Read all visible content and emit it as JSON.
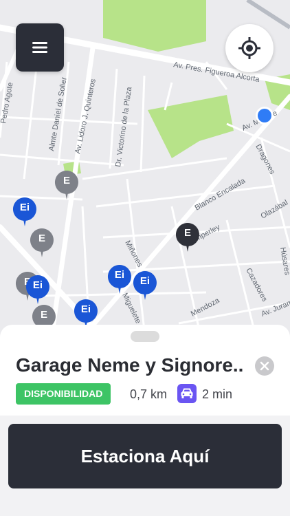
{
  "map": {
    "streets": [
      "Av. Pres. Figueroa Alcorta",
      "Pedro Agote",
      "Almte Daniel de Solier",
      "Av. Lidoro J. Quinteros",
      "Dr. Victorino de la Plaza",
      "Av. Monroe",
      "Dragones",
      "Blanco Encalada",
      "Olazábal",
      "Temperley",
      "Miñones",
      "Cazadores",
      "Mendoza",
      "Miguelete",
      "Av. Juramento",
      "Húsares"
    ],
    "pins": [
      {
        "label": "E",
        "color": "#7e8189"
      },
      {
        "label": "Ei",
        "color": "#1a56d6"
      },
      {
        "label": "E",
        "color": "#7e8189"
      },
      {
        "label": "E",
        "color": "#2f3139"
      },
      {
        "label": "Ei",
        "color": "#1a56d6"
      },
      {
        "label": "Ei",
        "color": "#1a56d6"
      },
      {
        "label": "E",
        "color": "#7e8189"
      },
      {
        "label": "Ei",
        "color": "#1a56d6"
      },
      {
        "label": "E",
        "color": "#7e8189"
      },
      {
        "label": "Ei",
        "color": "#1a56d6"
      }
    ]
  },
  "controls": {
    "menu_icon": "hamburger-menu-icon",
    "locate_icon": "crosshair-target-icon"
  },
  "sheet": {
    "name": "Garage Neme y Signore..",
    "badge": "DISPONIBILIDAD",
    "distance": "0,7 km",
    "eta": "2 min",
    "car_icon": "car-icon",
    "close_icon": "close-icon",
    "button_label": "Estaciona Aquí"
  },
  "colors": {
    "dark": "#2b2e38",
    "available_green": "#3dc465",
    "pin_blue": "#1a56d6",
    "pin_grey": "#7e8189",
    "car_purple": "#6a55f2",
    "park_green": "#b7e389",
    "user_dot": "#2f7cf6"
  }
}
